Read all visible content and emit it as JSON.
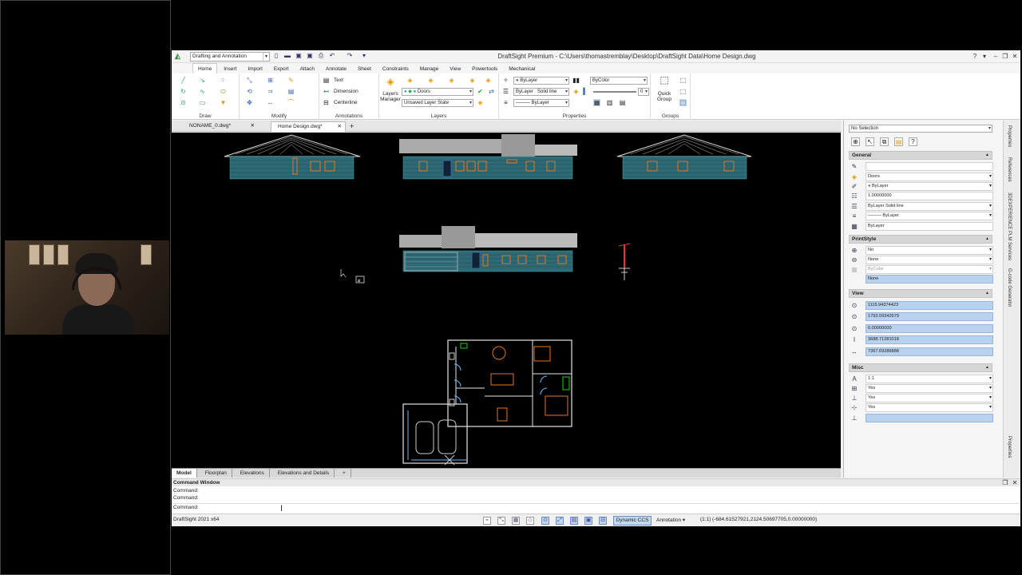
{
  "window": {
    "title": "DraftSight Premium - C:\\Users\\thomastremblay\\Desktop\\DraftSight Data\\Home Design.dwg",
    "workspace": "Drafting and Annotation",
    "minimize": "–",
    "restore": "❐",
    "close": "✕"
  },
  "menu_tabs": [
    "Home",
    "Insert",
    "Import",
    "Export",
    "Attach",
    "Annotate",
    "Sheet",
    "Constraints",
    "Manage",
    "View",
    "Powertools",
    "Mechanical"
  ],
  "ribbon": {
    "draw_label": "Draw",
    "modify_label": "Modify",
    "annotations_label": "Annotations",
    "layers_label": "Layers",
    "properties_label": "Properties",
    "groups_label": "Groups",
    "text_label": "Text",
    "dimension_label": "Dimension",
    "centerline_label": "Centerline",
    "layers_manager_label": "Layers Manager",
    "layer_value": "Doors",
    "layer_state": "Unsaved Layer State",
    "color_value": "ByLayer",
    "linestyle_value": "ByLayer",
    "linestyle_solid": "Solid line",
    "lineweight_value": "ByLayer",
    "bycolor_value": "ByColor",
    "transparency_value": "0",
    "quick_group_label": "Quick Group"
  },
  "doc_tabs": [
    {
      "label": "NONAME_0.dwg*"
    },
    {
      "label": "Home Design.dwg*"
    }
  ],
  "layout_tabs": [
    "Model",
    "Floorplan",
    "Elevations",
    "Elevations and Details"
  ],
  "properties": {
    "selection": "No Selection",
    "general_label": "General",
    "general": [
      "",
      "Doors",
      "ByLayer",
      "1.00000000",
      "ByLayer    Solid line",
      "——— ByLayer",
      "ByLayer"
    ],
    "printstyle_label": "PrintStyle",
    "printstyle": [
      "No",
      "None",
      "ByColor",
      "None"
    ],
    "view_label": "View",
    "view": [
      "1115.94374423",
      "1793.59342679",
      "0.00000000",
      "3688.71281018",
      "7367.69286888"
    ],
    "misc_label": "Misc",
    "misc": [
      "1:1",
      "Yes",
      "Yes",
      "Yes",
      ""
    ]
  },
  "right_tabs": [
    "Properties",
    "References",
    "3DEXPERIENCE PLM Services",
    "G-code Generator",
    "Properties"
  ],
  "command": {
    "title": "Command Window",
    "lines": [
      "Command:",
      "Command:",
      "Command:"
    ]
  },
  "status": {
    "version": "DraftSight 2021 x64",
    "dynamic_ccs": "Dynamic CCS",
    "annotation": "Annotation",
    "scale": "(1:1)",
    "coords": "(-684.61527921,2124.50697705,0.00000000)"
  },
  "colors": {
    "siding": "#2e6a75",
    "roof": "#d9d9d9",
    "window": "#e2751f",
    "walls": "#e6e6e6",
    "highlight": "#b7d1ee"
  }
}
